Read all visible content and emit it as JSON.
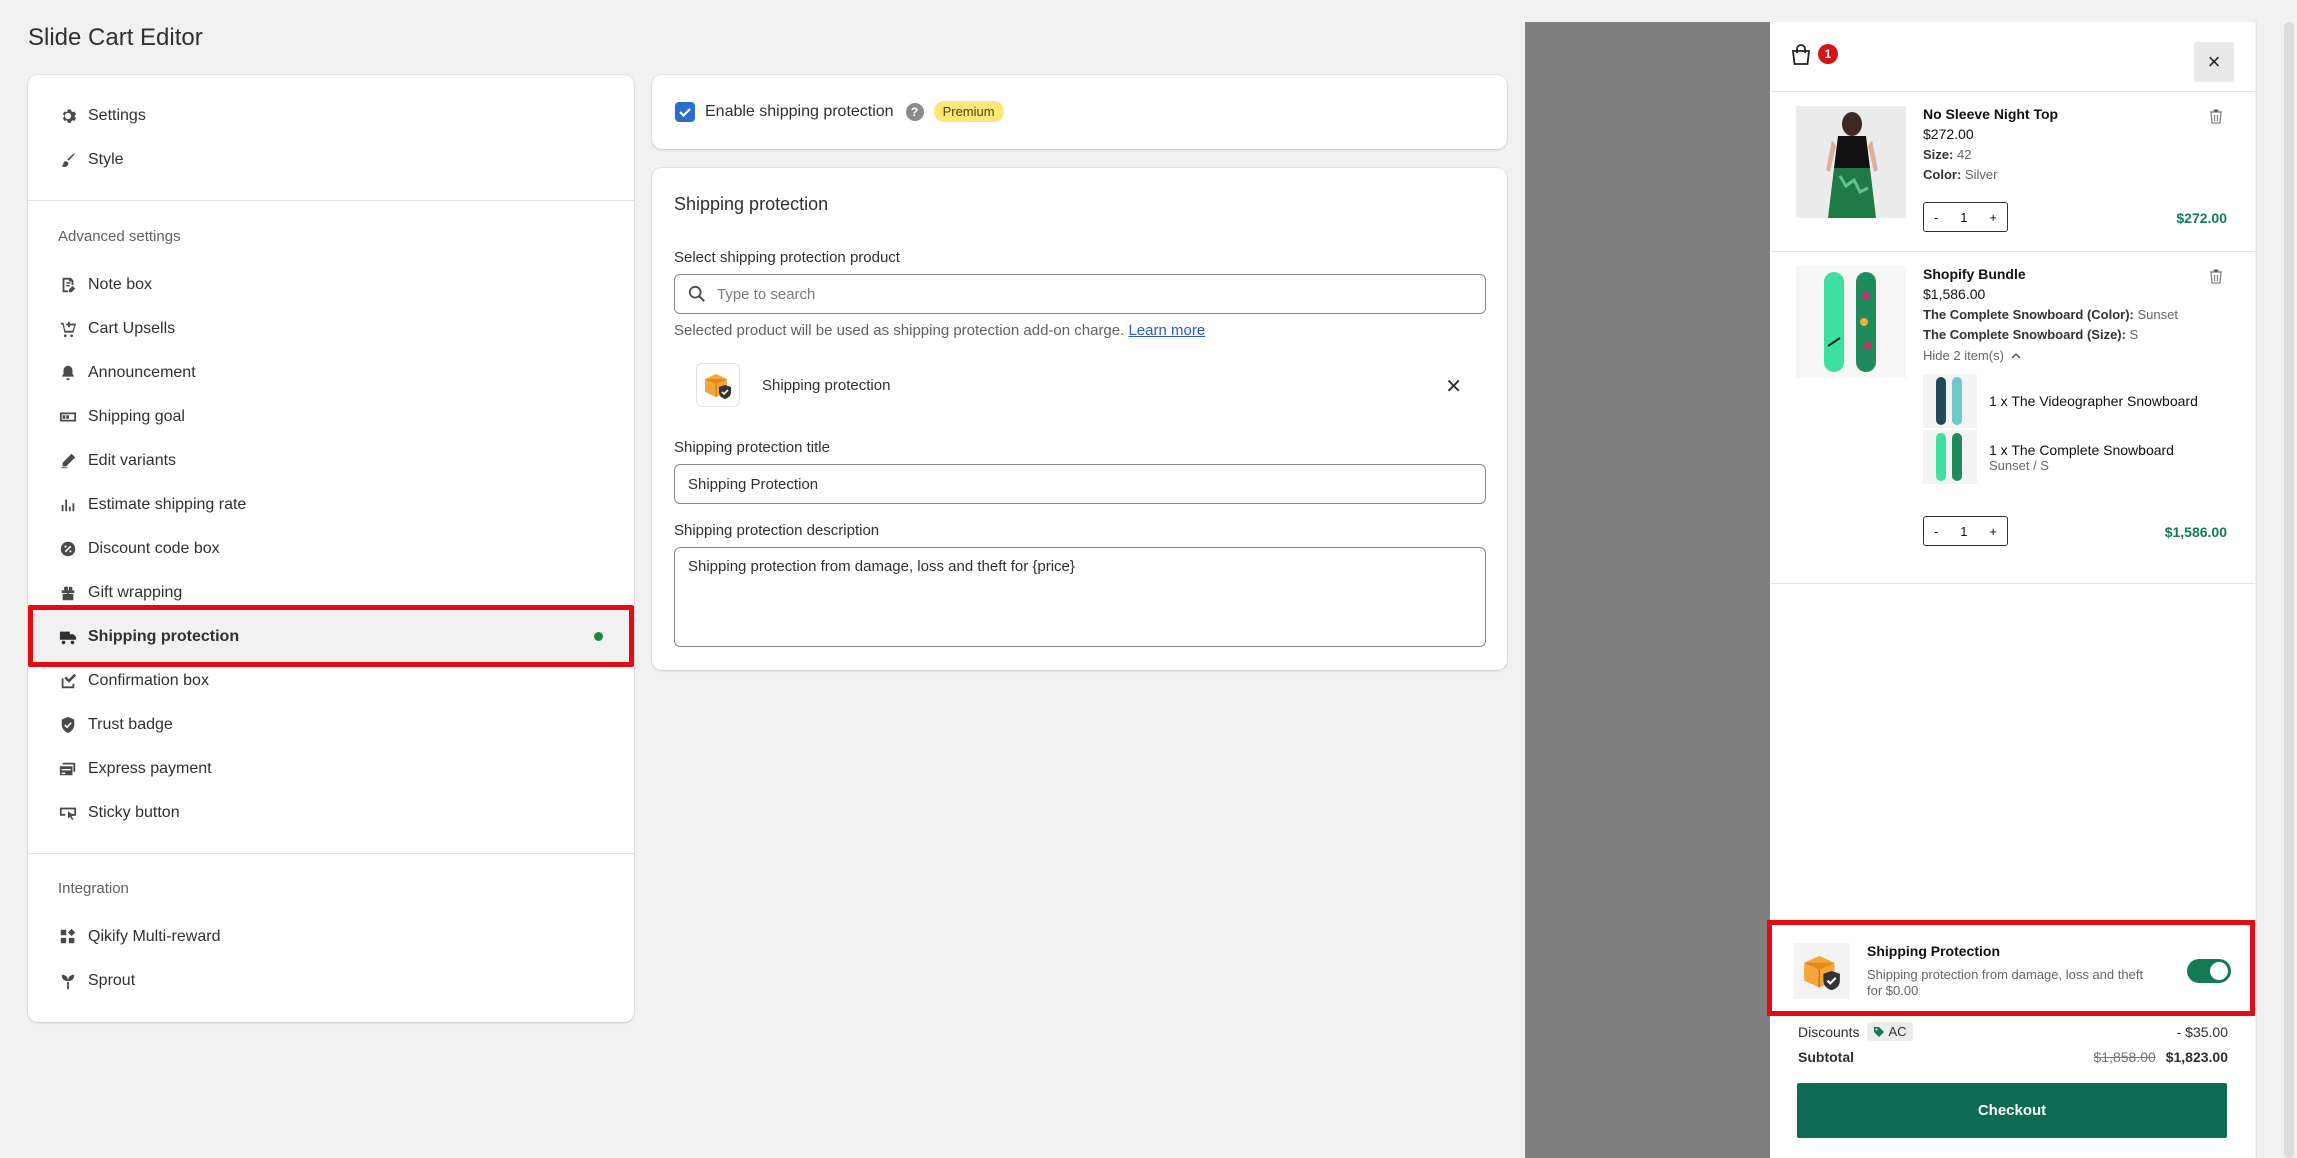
{
  "app": {
    "title": "Slide Cart Editor"
  },
  "sidebar": {
    "top_items": [
      {
        "label": "Settings",
        "icon": "gear-icon"
      },
      {
        "label": "Style",
        "icon": "brush-icon"
      }
    ],
    "advanced_title": "Advanced settings",
    "advanced_items": [
      {
        "label": "Note box",
        "icon": "note-icon"
      },
      {
        "label": "Cart Upsells",
        "icon": "cart-upsell-icon"
      },
      {
        "label": "Announcement",
        "icon": "bell-icon"
      },
      {
        "label": "Shipping goal",
        "icon": "progress-icon"
      },
      {
        "label": "Edit variants",
        "icon": "pencil-icon"
      },
      {
        "label": "Estimate shipping rate",
        "icon": "bar-chart-icon"
      },
      {
        "label": "Discount code box",
        "icon": "discount-icon"
      },
      {
        "label": "Gift wrapping",
        "icon": "gift-icon"
      },
      {
        "label": "Shipping protection",
        "icon": "truck-icon",
        "active": true
      },
      {
        "label": "Confirmation box",
        "icon": "checkbox-icon"
      },
      {
        "label": "Trust badge",
        "icon": "shield-icon"
      },
      {
        "label": "Express payment",
        "icon": "card-icon"
      },
      {
        "label": "Sticky button",
        "icon": "sticky-button-icon"
      }
    ],
    "integration_title": "Integration",
    "integration_items": [
      {
        "label": "Qikify Multi-reward",
        "icon": "apps-icon"
      },
      {
        "label": "Sprout",
        "icon": "sprout-icon"
      }
    ]
  },
  "enable": {
    "label": "Enable shipping protection",
    "help": "?",
    "badge": "Premium",
    "checked": true
  },
  "shipping_protection": {
    "heading": "Shipping protection",
    "product_label": "Select shipping protection product",
    "search_placeholder": "Type to search",
    "help_text": "Selected product will be used as shipping protection add-on charge.",
    "help_link": "Learn more",
    "selected_product": "Shipping protection",
    "title_label": "Shipping protection title",
    "title_value": "Shipping Protection",
    "description_label": "Shipping protection description",
    "description_value": "Shipping protection from damage, loss and theft for {price}"
  },
  "cart": {
    "count": "1",
    "close": "×",
    "items": [
      {
        "name": "No Sleeve Night Top",
        "price": "$272.00",
        "props": [
          {
            "key": "Size:",
            "value": "42"
          },
          {
            "key": "Color:",
            "value": "Silver"
          }
        ],
        "qty": "1",
        "total": "$272.00"
      },
      {
        "name": "Shopify Bundle",
        "price": "$1,586.00",
        "props": [
          {
            "key": "The Complete Snowboard (Color):",
            "value": "Sunset"
          },
          {
            "key": "The Complete Snowboard (Size):",
            "value": "S"
          }
        ],
        "toggle_label": "Hide 2 item(s)",
        "sub_items": [
          {
            "label": "1 x The Videographer Snowboard",
            "variant": ""
          },
          {
            "label": "1 x The Complete Snowboard",
            "variant": "Sunset / S"
          }
        ],
        "qty": "1",
        "total": "$1,586.00"
      }
    ],
    "protection": {
      "title": "Shipping Protection",
      "description": "Shipping protection from damage, loss and theft for $0.00",
      "enabled": true
    },
    "discounts_label": "Discounts",
    "discount_code": "AC",
    "discount_value": "- $35.00",
    "subtotal_label": "Subtotal",
    "subtotal_original": "$1,858.00",
    "subtotal_value": "$1,823.00",
    "checkout_label": "Checkout",
    "qty_minus": "-",
    "qty_plus": "+"
  },
  "colors": {
    "accent_red": "#e50a13",
    "checkout_green": "#0c6b50",
    "price_green": "#137a55",
    "checkbox_blue": "#2c6ecb"
  }
}
